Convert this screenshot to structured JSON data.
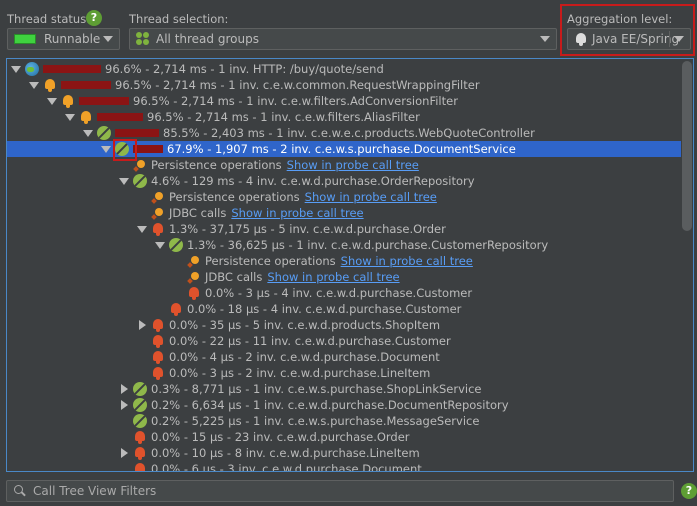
{
  "header": {
    "thread_status_label": "Thread status:",
    "thread_status_value": "Runnable",
    "thread_selection_label": "Thread selection:",
    "thread_selection_value": "All thread groups",
    "aggregation_label": "Aggregation level:",
    "aggregation_value": "Java EE/Spring",
    "help": "?"
  },
  "colors": {
    "accent": "#2f65ca",
    "bar": "#8b1414",
    "highlight": "#c71b1b",
    "link": "#589df6"
  },
  "tree": {
    "rows": [
      {
        "indent": 0,
        "toggle": "open",
        "icon": "globe",
        "bar": 58,
        "text": "96.6% - 2,714 ms - 1 inv. HTTP: /buy/quote/send"
      },
      {
        "indent": 1,
        "toggle": "open",
        "icon": "bell",
        "bar": 50,
        "text": "96.5% - 2,714 ms - 1 inv. c.e.w.common.RequestWrappingFilter"
      },
      {
        "indent": 2,
        "toggle": "open",
        "icon": "bell",
        "bar": 50,
        "text": "96.5% - 2,714 ms - 1 inv. c.e.w.filters.AdConversionFilter"
      },
      {
        "indent": 3,
        "toggle": "open",
        "icon": "bell",
        "bar": 46,
        "text": "96.5% - 2,714 ms - 1 inv. c.e.w.filters.AliasFilter"
      },
      {
        "indent": 4,
        "toggle": "open",
        "icon": "bean",
        "bar": 44,
        "text": "85.5% - 2,403 ms - 1 inv. c.e.w.e.c.products.WebQuoteController"
      },
      {
        "indent": 5,
        "toggle": "open",
        "icon": "bean",
        "bar": 30,
        "text": "67.9% - 1,907 ms - 2 inv. c.e.w.s.purchase.DocumentService",
        "selected": true
      },
      {
        "indent": 6,
        "toggle": "none",
        "icon": "probe",
        "bar": 0,
        "text": "Persistence operations",
        "link": "Show in probe call tree"
      },
      {
        "indent": 6,
        "toggle": "open",
        "icon": "bean",
        "bar": 0,
        "text": "4.6% - 129 ms - 4 inv. c.e.w.d.purchase.OrderRepository"
      },
      {
        "indent": 7,
        "toggle": "none",
        "icon": "probe",
        "bar": 0,
        "text": "Persistence operations",
        "link": "Show in probe call tree"
      },
      {
        "indent": 7,
        "toggle": "none",
        "icon": "probe",
        "bar": 0,
        "text": "JDBC calls",
        "link": "Show in probe call tree"
      },
      {
        "indent": 7,
        "toggle": "open",
        "icon": "red",
        "bar": 0,
        "text": "1.3% - 37,175 µs - 5 inv. c.e.w.d.purchase.Order"
      },
      {
        "indent": 8,
        "toggle": "open",
        "icon": "bean",
        "bar": 0,
        "text": "1.3% - 36,625 µs - 1 inv. c.e.w.d.purchase.CustomerRepository"
      },
      {
        "indent": 9,
        "toggle": "none",
        "icon": "probe",
        "bar": 0,
        "text": "Persistence operations",
        "link": "Show in probe call tree"
      },
      {
        "indent": 9,
        "toggle": "none",
        "icon": "probe",
        "bar": 0,
        "text": "JDBC calls",
        "link": "Show in probe call tree"
      },
      {
        "indent": 9,
        "toggle": "none",
        "icon": "red",
        "bar": 0,
        "text": "0.0% - 3 µs - 4 inv. c.e.w.d.purchase.Customer"
      },
      {
        "indent": 8,
        "toggle": "none",
        "icon": "red",
        "bar": 0,
        "text": "0.0% - 18 µs - 4 inv. c.e.w.d.purchase.Customer"
      },
      {
        "indent": 7,
        "toggle": "closed",
        "icon": "red",
        "bar": 0,
        "text": "0.0% - 35 µs - 5 inv. c.e.w.d.products.ShopItem"
      },
      {
        "indent": 7,
        "toggle": "none",
        "icon": "red",
        "bar": 0,
        "text": "0.0% - 22 µs - 11 inv. c.e.w.d.purchase.Customer"
      },
      {
        "indent": 7,
        "toggle": "none",
        "icon": "red",
        "bar": 0,
        "text": "0.0% - 4 µs - 2 inv. c.e.w.d.purchase.Document"
      },
      {
        "indent": 7,
        "toggle": "none",
        "icon": "red",
        "bar": 0,
        "text": "0.0% - 3 µs - 2 inv. c.e.w.d.purchase.LineItem"
      },
      {
        "indent": 6,
        "toggle": "closed",
        "icon": "bean",
        "bar": 0,
        "text": "0.3% - 8,771 µs - 1 inv. c.e.w.s.purchase.ShopLinkService"
      },
      {
        "indent": 6,
        "toggle": "closed",
        "icon": "bean",
        "bar": 0,
        "text": "0.2% - 6,634 µs - 1 inv. c.e.w.d.purchase.DocumentRepository"
      },
      {
        "indent": 6,
        "toggle": "none",
        "icon": "bean",
        "bar": 0,
        "text": "0.2% - 5,225 µs - 1 inv. c.e.w.s.purchase.MessageService"
      },
      {
        "indent": 6,
        "toggle": "none",
        "icon": "red",
        "bar": 0,
        "text": "0.0% - 15 µs - 23 inv. c.e.w.d.purchase.Order"
      },
      {
        "indent": 6,
        "toggle": "closed",
        "icon": "red",
        "bar": 0,
        "text": "0.0% - 10 µs - 8 inv. c.e.w.d.purchase.LineItem"
      },
      {
        "indent": 6,
        "toggle": "none",
        "icon": "red",
        "bar": 0,
        "text": "0.0% - 6 µs - 3 inv. c.e.w.d.purchase.Document"
      }
    ]
  },
  "filter": {
    "placeholder": "Call Tree View Filters"
  }
}
